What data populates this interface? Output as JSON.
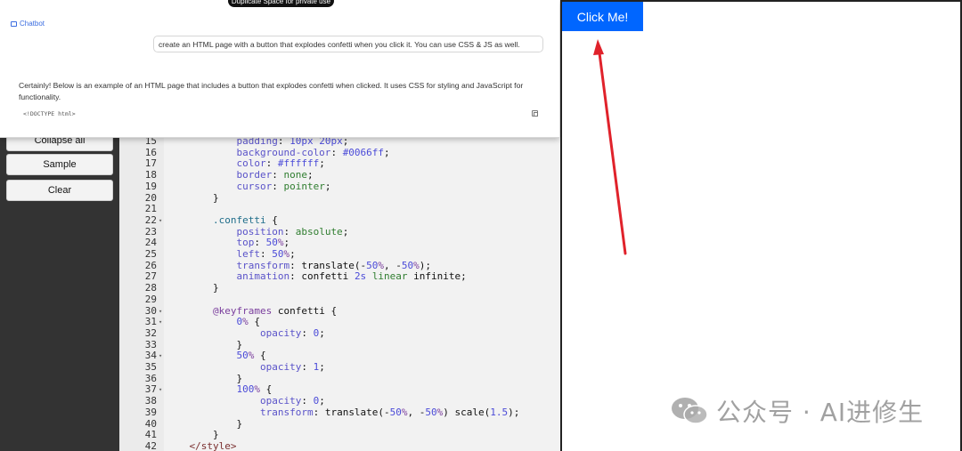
{
  "chat": {
    "badge": "Duplicate Space for private use",
    "label": "Chatbot",
    "user_message": "create an HTML page with a button that explodes confetti when you click it. You can use CSS & JS as well.",
    "bot_message": "Certainly! Below is an example of an HTML page that includes a button that explodes confetti when clicked. It uses CSS for styling and JavaScript for functionality.",
    "code_start": "<!DOCTYPE html>"
  },
  "sidebar": {
    "buttons": [
      "Collapse all",
      "Sample",
      "Clear"
    ]
  },
  "code_lines": [
    {
      "n": "15",
      "fold": false,
      "seg": [
        [
          "prop",
          "            padding"
        ],
        [
          "plain",
          ": "
        ],
        [
          "num",
          "10px 20px"
        ],
        [
          "plain",
          ";"
        ]
      ]
    },
    {
      "n": "16",
      "fold": false,
      "seg": [
        [
          "prop",
          "            background-color"
        ],
        [
          "plain",
          ": "
        ],
        [
          "num",
          "#0066ff"
        ],
        [
          "plain",
          ";"
        ]
      ]
    },
    {
      "n": "17",
      "fold": false,
      "seg": [
        [
          "prop",
          "            color"
        ],
        [
          "plain",
          ": "
        ],
        [
          "num",
          "#ffffff"
        ],
        [
          "plain",
          ";"
        ]
      ]
    },
    {
      "n": "18",
      "fold": false,
      "seg": [
        [
          "prop",
          "            border"
        ],
        [
          "plain",
          ": "
        ],
        [
          "val-str",
          "none"
        ],
        [
          "plain",
          ";"
        ]
      ]
    },
    {
      "n": "19",
      "fold": false,
      "seg": [
        [
          "prop",
          "            cursor"
        ],
        [
          "plain",
          ": "
        ],
        [
          "val-str",
          "pointer"
        ],
        [
          "plain",
          ";"
        ]
      ]
    },
    {
      "n": "20",
      "fold": false,
      "seg": [
        [
          "plain",
          "        }"
        ]
      ]
    },
    {
      "n": "21",
      "fold": false,
      "seg": [
        [
          "plain",
          ""
        ]
      ]
    },
    {
      "n": "22",
      "fold": true,
      "seg": [
        [
          "sel",
          "        .confetti"
        ],
        [
          "plain",
          " {"
        ]
      ]
    },
    {
      "n": "23",
      "fold": false,
      "seg": [
        [
          "prop",
          "            position"
        ],
        [
          "plain",
          ": "
        ],
        [
          "val-str",
          "absolute"
        ],
        [
          "plain",
          ";"
        ]
      ]
    },
    {
      "n": "24",
      "fold": false,
      "seg": [
        [
          "prop",
          "            top"
        ],
        [
          "plain",
          ": "
        ],
        [
          "num",
          "50"
        ],
        [
          "pct",
          "%"
        ],
        [
          "plain",
          ";"
        ]
      ]
    },
    {
      "n": "25",
      "fold": false,
      "seg": [
        [
          "prop",
          "            left"
        ],
        [
          "plain",
          ": "
        ],
        [
          "num",
          "50"
        ],
        [
          "pct",
          "%"
        ],
        [
          "plain",
          ";"
        ]
      ]
    },
    {
      "n": "26",
      "fold": false,
      "seg": [
        [
          "prop",
          "            transform"
        ],
        [
          "plain",
          ": translate(-"
        ],
        [
          "num",
          "50"
        ],
        [
          "pct",
          "%"
        ],
        [
          "plain",
          ", -"
        ],
        [
          "num",
          "50"
        ],
        [
          "pct",
          "%"
        ],
        [
          "plain",
          ");"
        ]
      ]
    },
    {
      "n": "27",
      "fold": false,
      "seg": [
        [
          "prop",
          "            animation"
        ],
        [
          "plain",
          ": confetti "
        ],
        [
          "num",
          "2s"
        ],
        [
          "plain",
          " "
        ],
        [
          "val-str",
          "linear"
        ],
        [
          "plain",
          " infinite;"
        ]
      ]
    },
    {
      "n": "28",
      "fold": false,
      "seg": [
        [
          "plain",
          "        }"
        ]
      ]
    },
    {
      "n": "29",
      "fold": false,
      "seg": [
        [
          "plain",
          ""
        ]
      ]
    },
    {
      "n": "30",
      "fold": true,
      "seg": [
        [
          "kw",
          "        @keyframes"
        ],
        [
          "plain",
          " confetti {"
        ]
      ]
    },
    {
      "n": "31",
      "fold": true,
      "seg": [
        [
          "num",
          "            0"
        ],
        [
          "pct",
          "%"
        ],
        [
          "plain",
          " {"
        ]
      ]
    },
    {
      "n": "32",
      "fold": false,
      "seg": [
        [
          "prop",
          "                opacity"
        ],
        [
          "plain",
          ": "
        ],
        [
          "num",
          "0"
        ],
        [
          "plain",
          ";"
        ]
      ]
    },
    {
      "n": "33",
      "fold": false,
      "seg": [
        [
          "plain",
          "            }"
        ]
      ]
    },
    {
      "n": "34",
      "fold": true,
      "seg": [
        [
          "num",
          "            50"
        ],
        [
          "pct",
          "%"
        ],
        [
          "plain",
          " {"
        ]
      ]
    },
    {
      "n": "35",
      "fold": false,
      "seg": [
        [
          "prop",
          "                opacity"
        ],
        [
          "plain",
          ": "
        ],
        [
          "num",
          "1"
        ],
        [
          "plain",
          ";"
        ]
      ]
    },
    {
      "n": "36",
      "fold": false,
      "seg": [
        [
          "plain",
          "            }"
        ]
      ]
    },
    {
      "n": "37",
      "fold": true,
      "seg": [
        [
          "num",
          "            100"
        ],
        [
          "pct",
          "%"
        ],
        [
          "plain",
          " {"
        ]
      ]
    },
    {
      "n": "38",
      "fold": false,
      "seg": [
        [
          "prop",
          "                opacity"
        ],
        [
          "plain",
          ": "
        ],
        [
          "num",
          "0"
        ],
        [
          "plain",
          ";"
        ]
      ]
    },
    {
      "n": "39",
      "fold": false,
      "seg": [
        [
          "prop",
          "                transform"
        ],
        [
          "plain",
          ": translate(-"
        ],
        [
          "num",
          "50"
        ],
        [
          "pct",
          "%"
        ],
        [
          "plain",
          ", -"
        ],
        [
          "num",
          "50"
        ],
        [
          "pct",
          "%"
        ],
        [
          "plain",
          ") scale("
        ],
        [
          "num",
          "1.5"
        ],
        [
          "plain",
          ");"
        ]
      ]
    },
    {
      "n": "40",
      "fold": false,
      "seg": [
        [
          "plain",
          "            }"
        ]
      ]
    },
    {
      "n": "41",
      "fold": false,
      "seg": [
        [
          "plain",
          "        }"
        ]
      ]
    },
    {
      "n": "42",
      "fold": false,
      "seg": [
        [
          "tag",
          "    </style>"
        ]
      ]
    }
  ],
  "preview": {
    "button_label": "Click Me!",
    "button_color": "#0066ff",
    "arrow_color": "#e0222b"
  },
  "watermark": {
    "text": "公众号 · AI进修生",
    "icon": "wechat-icon"
  }
}
